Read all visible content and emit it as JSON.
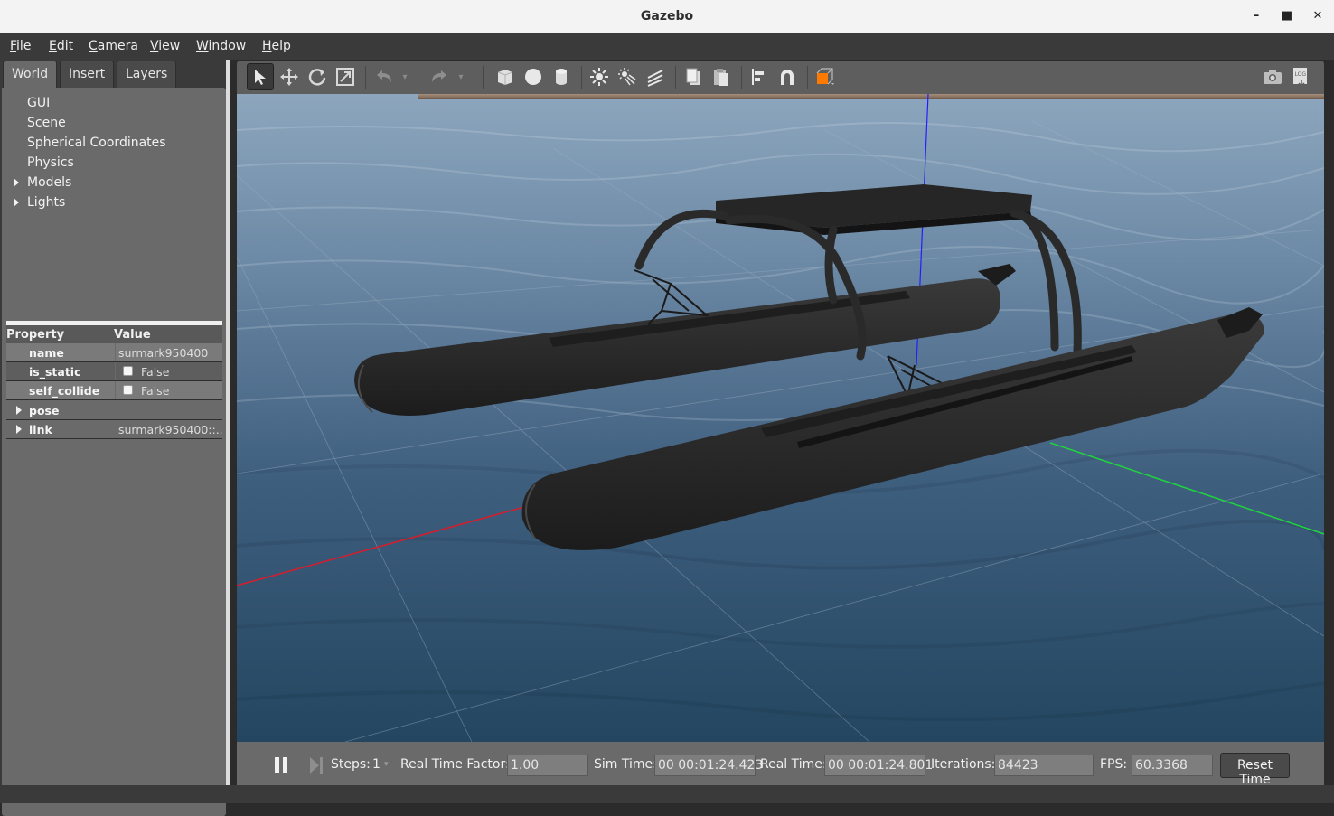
{
  "window": {
    "title": "Gazebo"
  },
  "menubar": [
    {
      "underline": "F",
      "rest": "ile"
    },
    {
      "underline": "E",
      "rest": "dit"
    },
    {
      "underline": "C",
      "rest": "amera"
    },
    {
      "underline": "V",
      "rest": "iew"
    },
    {
      "underline": "W",
      "rest": "indow"
    },
    {
      "underline": "H",
      "rest": "elp"
    }
  ],
  "tabs": [
    "World",
    "Insert",
    "Layers"
  ],
  "tree": [
    "GUI",
    "Scene",
    "Spherical Coordinates",
    "Physics",
    "Models",
    "Lights"
  ],
  "properties": {
    "header": {
      "property": "Property",
      "value": "Value"
    },
    "rows": [
      {
        "key": "name",
        "value": "surmark950400"
      },
      {
        "key": "is_static",
        "value": "False"
      },
      {
        "key": "self_collide",
        "value": "False"
      },
      {
        "key": "pose",
        "value": ""
      },
      {
        "key": "link",
        "value": "surmark950400::..."
      }
    ]
  },
  "toolbar": {
    "icons": [
      "select-arrow-icon",
      "translate-icon",
      "rotate-icon",
      "scale-icon",
      "undo-icon",
      "undo-dropdown-icon",
      "redo-icon",
      "redo-dropdown-icon",
      "box-icon",
      "sphere-icon",
      "cylinder-icon",
      "point-light-icon",
      "spot-light-icon",
      "directional-light-icon",
      "copy-icon",
      "paste-icon",
      "align-icon",
      "snap-magnet-icon",
      "view-angle-icon",
      "screenshot-camera-icon",
      "log-icon"
    ]
  },
  "bottom": {
    "steps_label": "Steps:",
    "steps_value": "1",
    "rtf_label": "Real Time Factor:",
    "rtf_value": "1.00",
    "sim_label": "Sim Time:",
    "sim_value": "00 00:01:24.423",
    "real_label": "Real Time:",
    "real_value": "00 00:01:24.801",
    "iter_label": "Iterations:",
    "iter_value": "84423",
    "fps_label": "FPS:",
    "fps_value": "60.3368",
    "reset_label": "Reset Time"
  },
  "colors": {
    "x_axis": "#d02030",
    "y_axis": "#20d040",
    "z_axis": "#2020ff",
    "water": "#3d5a7a",
    "boat": "#2a2a2a",
    "accent_orange": "#ff7a00"
  }
}
